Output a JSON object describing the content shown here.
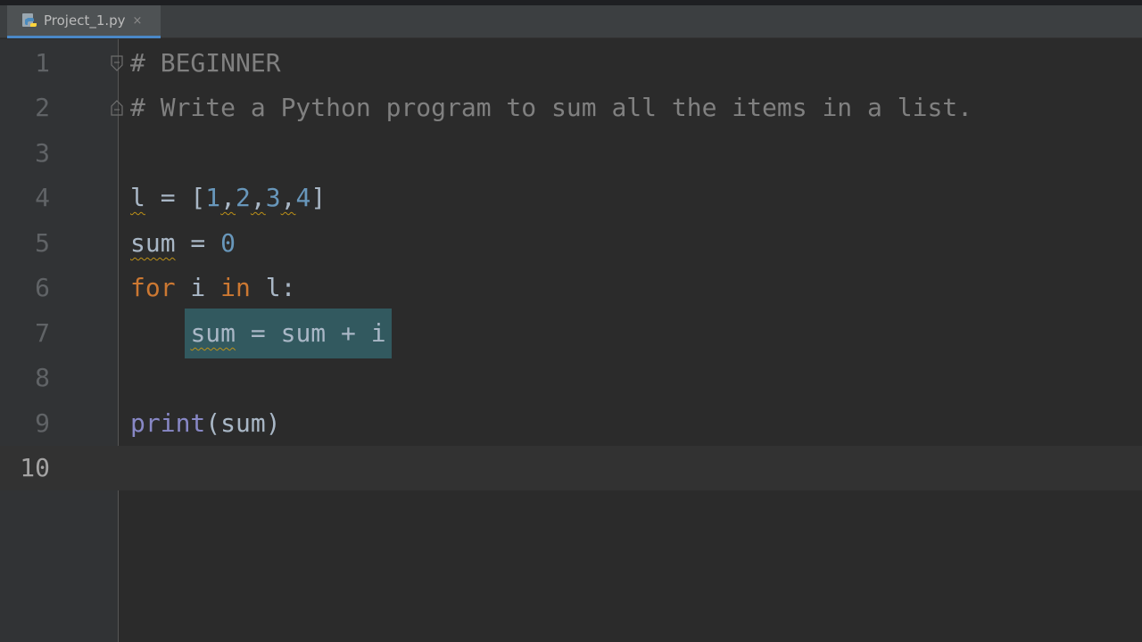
{
  "tab": {
    "filename": "Project_1.py",
    "close_glyph": "×",
    "icon": "python-file-icon"
  },
  "colors": {
    "background": "#2b2b2b",
    "gutter": "#313335",
    "comment": "#808080",
    "keyword": "#cc7832",
    "number": "#6897bb",
    "builtin": "#8888c6",
    "identifier": "#a9b7c6",
    "selection": "#32595f",
    "tab_underline": "#4a88c7"
  },
  "lines": [
    {
      "num": "1",
      "text": "# BEGINNER"
    },
    {
      "num": "2",
      "text": "# Write a Python program to sum all the items in a list."
    },
    {
      "num": "3",
      "text": ""
    },
    {
      "num": "4",
      "text": "l = [1,2,3,4]"
    },
    {
      "num": "5",
      "text": "sum = 0"
    },
    {
      "num": "6",
      "text": "for i in l:"
    },
    {
      "num": "7",
      "text": "    sum = sum + i"
    },
    {
      "num": "8",
      "text": ""
    },
    {
      "num": "9",
      "text": "print(sum)"
    },
    {
      "num": "10",
      "text": ""
    }
  ],
  "tokens": {
    "l1_comment": "# BEGINNER",
    "l2_comment": "# Write a Python program to sum all the items in a list.",
    "l4_var": "l",
    "l4_eq": " = [",
    "l4_n1": "1",
    "l4_c1": ",",
    "l4_n2": "2",
    "l4_c2": ",",
    "l4_n3": "3",
    "l4_c3": ",",
    "l4_n4": "4",
    "l4_close": "]",
    "l5_var": "sum",
    "l5_eq": " = ",
    "l5_num": "0",
    "l6_for": "for",
    "l6_i": " i ",
    "l6_in": "in",
    "l6_rest": " l:",
    "l7_indent": "    ",
    "l7_sum": "sum",
    "l7_rest": " = sum + i",
    "l9_print": "print",
    "l9_rest": "(sum)"
  },
  "current_line": "10"
}
